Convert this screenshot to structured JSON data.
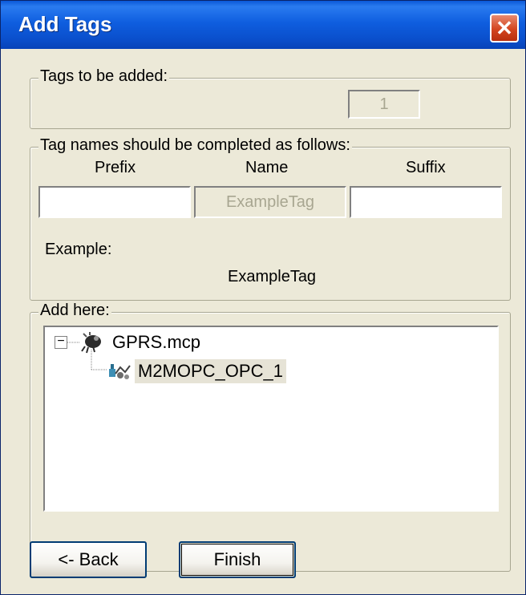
{
  "window": {
    "title": "Add Tags",
    "close_glyph": "✕"
  },
  "tags_to_be_added": {
    "legend": "Tags to be added:",
    "count": "1"
  },
  "tag_names": {
    "legend": "Tag names should be completed as follows:",
    "prefix_label": "Prefix",
    "name_label": "Name",
    "suffix_label": "Suffix",
    "prefix_value": "",
    "name_value": "ExampleTag",
    "suffix_value": "",
    "example_label": "Example:",
    "example_value": "ExampleTag"
  },
  "add_here": {
    "legend": "Add here:",
    "tree": {
      "root": {
        "label": "GPRS.mcp",
        "expand_glyph": "−",
        "icon": "project-icon"
      },
      "child": {
        "label": "M2MOPC_OPC_1",
        "icon": "opc-server-icon",
        "selected": true
      }
    }
  },
  "buttons": {
    "back": "<- Back",
    "finish": "Finish"
  }
}
